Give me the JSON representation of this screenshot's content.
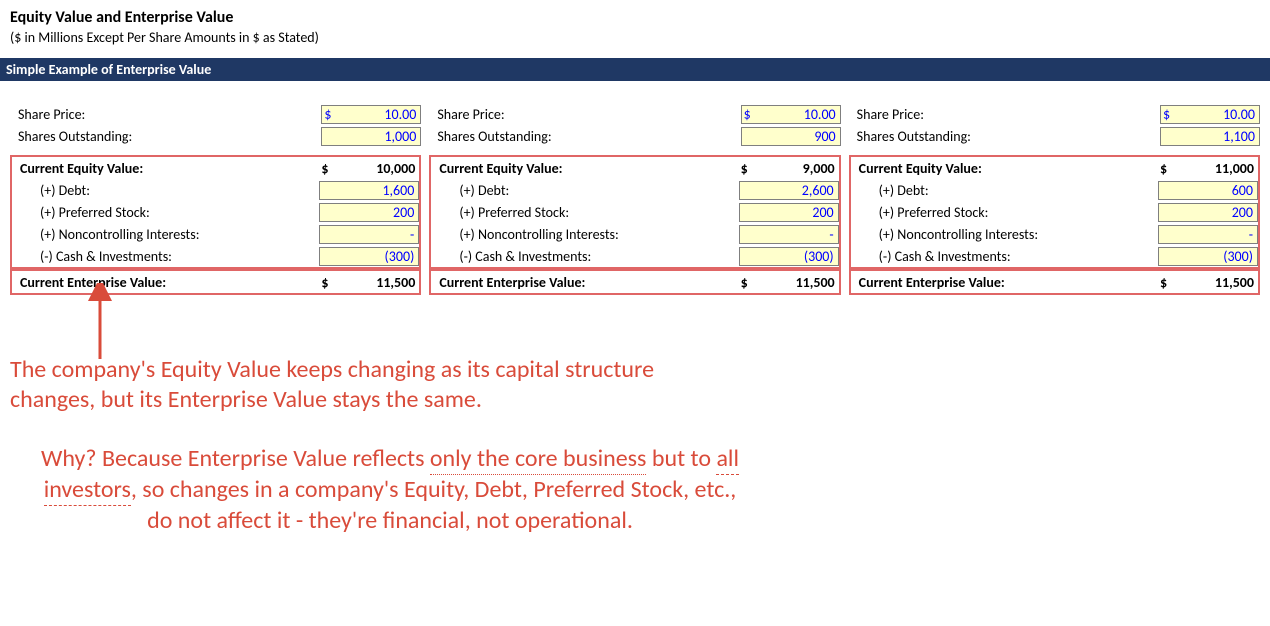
{
  "title": "Equity Value and Enterprise Value",
  "subtitle": "($ in Millions Except Per Share Amounts in $ as Stated)",
  "sectionHeader": "Simple Example of Enterprise Value",
  "labels": {
    "sharePrice": "Share Price:",
    "sharesOutstanding": "Shares Outstanding:",
    "currentEquityValue": "Current Equity Value:",
    "debt": "(+) Debt:",
    "preferred": "(+) Preferred Stock:",
    "nci": "(+) Noncontrolling Interests:",
    "cash": "(-) Cash & Investments:",
    "currentEV": "Current Enterprise Value:"
  },
  "scenarios": [
    {
      "sharePrice": "10.00",
      "sharesOutstanding": "1,000",
      "equityValue": "10,000",
      "debt": "1,600",
      "preferred": "200",
      "nci": "-",
      "cash": "(300)",
      "enterpriseValue": "11,500"
    },
    {
      "sharePrice": "10.00",
      "sharesOutstanding": "900",
      "equityValue": "9,000",
      "debt": "2,600",
      "preferred": "200",
      "nci": "-",
      "cash": "(300)",
      "enterpriseValue": "11,500"
    },
    {
      "sharePrice": "10.00",
      "sharesOutstanding": "1,100",
      "equityValue": "11,000",
      "debt": "600",
      "preferred": "200",
      "nci": "-",
      "cash": "(300)",
      "enterpriseValue": "11,500"
    }
  ],
  "annotation1": "The company's Equity Value keeps changing as its capital structure changes, but its Enterprise Value stays the same.",
  "annotation2_parts": {
    "a": "Why? Because Enterprise Value reflects ",
    "u1": "only the core business",
    "b": " but to ",
    "u2": "all investors",
    "c": ", so changes in a company's Equity, Debt, Preferred Stock, etc., do not affect it - they're financial, not operational."
  },
  "currency": "$"
}
